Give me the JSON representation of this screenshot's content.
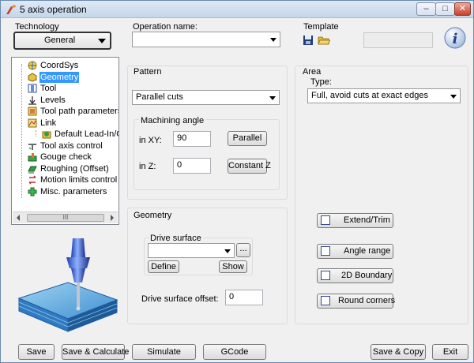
{
  "window": {
    "title": "5 axis operation"
  },
  "technology": {
    "label": "Technology",
    "value": "General"
  },
  "operation": {
    "label": "Operation name:",
    "value": ""
  },
  "template": {
    "label": "Template"
  },
  "tree": {
    "items": [
      {
        "label": "CoordSys",
        "icon": "coordsys-icon"
      },
      {
        "label": "Geometry",
        "icon": "geometry-icon",
        "selected": true
      },
      {
        "label": "Tool",
        "icon": "tool-icon"
      },
      {
        "label": "Levels",
        "icon": "levels-icon"
      },
      {
        "label": "Tool path parameters",
        "icon": "toolpath-icon"
      },
      {
        "label": "Link",
        "icon": "link-icon"
      },
      {
        "label": "Default Lead-In/Out",
        "icon": "leadin-icon"
      },
      {
        "label": "Tool axis control",
        "icon": "tool-axis-icon"
      },
      {
        "label": "Gouge check",
        "icon": "gouge-icon"
      },
      {
        "label": "Roughing (Offset)",
        "icon": "roughing-icon"
      },
      {
        "label": "Motion limits control",
        "icon": "motion-limits-icon"
      },
      {
        "label": "Misc. parameters",
        "icon": "misc-icon"
      }
    ],
    "scroll_thumb": "III"
  },
  "pattern": {
    "label": "Pattern",
    "value": "Parallel cuts",
    "machining_angle": {
      "label": "Machining angle",
      "xy_label": "in XY:",
      "xy_value": "90",
      "z_label": "in Z:",
      "z_value": "0",
      "parallel_button": "Parallel",
      "constant_z_button": "Constant Z"
    }
  },
  "area": {
    "label": "Area",
    "type_label": "Type:",
    "type_value": "Full, avoid cuts at exact edges"
  },
  "geometry": {
    "label": "Geometry",
    "drive_surface_label": "Drive surface",
    "drive_surface_value": "",
    "browse_button": "...",
    "define_button": "Define",
    "show_button": "Show",
    "offset_label": "Drive surface offset:",
    "offset_value": "0"
  },
  "options": {
    "extend_trim": "Extend/Trim",
    "angle_range": "Angle range",
    "boundary_2d": "2D Boundary",
    "round_corners": "Round corners"
  },
  "footer": {
    "save": "Save",
    "save_calculate": "Save & Calculate",
    "simulate": "Simulate",
    "gcode": "GCode",
    "save_copy": "Save & Copy",
    "exit": "Exit"
  }
}
